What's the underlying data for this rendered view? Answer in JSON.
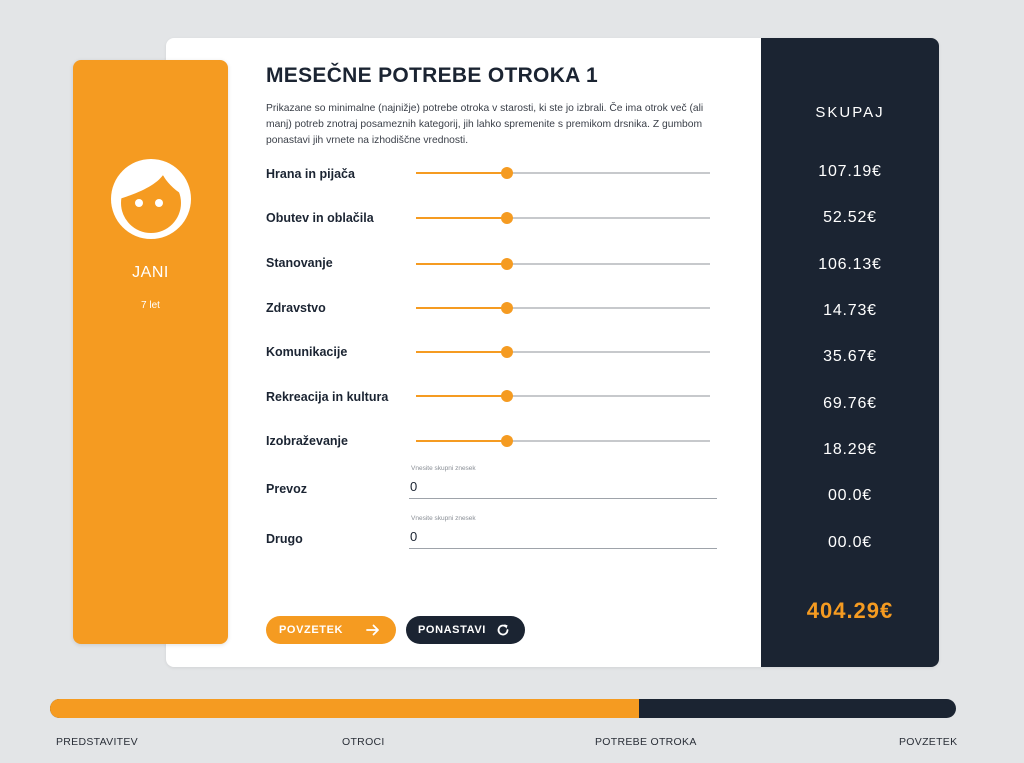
{
  "child": {
    "name": "JANI",
    "age": "7 let",
    "avatar_icon": "child-face-icon"
  },
  "main": {
    "title": "MESEČNE POTREBE OTROKA 1",
    "description": "Prikazane so minimalne (najnižje) potrebe otroka v starosti, ki ste jo izbrali. Če ima otrok več (ali manj) potreb znotraj posameznih kategorij, jih lahko spremenite s premikom drsnika. Z gumbom ponastavi jih vrnete na izhodiščne vrednosti.",
    "sliders": [
      {
        "label": "Hrana in pijača",
        "level": 0.31
      },
      {
        "label": "Obutev in oblačila",
        "level": 0.31
      },
      {
        "label": "Stanovanje",
        "level": 0.31
      },
      {
        "label": "Zdravstvo",
        "level": 0.31
      },
      {
        "label": "Komunikacije",
        "level": 0.31
      },
      {
        "label": "Rekreacija in kultura",
        "level": 0.31
      },
      {
        "label": "Izobraževanje",
        "level": 0.31
      }
    ],
    "inputs": [
      {
        "label": "Prevoz",
        "field_label": "Vnesite skupni znesek",
        "value": "0"
      },
      {
        "label": "Drugo",
        "field_label": "Vnesite skupni znesek",
        "value": "0"
      }
    ],
    "buttons": {
      "summary_label": "POVZETEK",
      "summary_icon": "arrow-right-icon",
      "reset_label": "PONASTAVI",
      "reset_icon": "refresh-icon"
    }
  },
  "totals": {
    "title": "SKUPAJ",
    "amounts": [
      "107.19€",
      "52.52€",
      "106.13€",
      "14.73€",
      "35.67€",
      "69.76€",
      "18.29€",
      "00.0€",
      "00.0€"
    ],
    "grand_total": "404.29€"
  },
  "progress": {
    "fraction": 0.65,
    "steps": [
      "PREDSTAVITEV",
      "OTROCI",
      "POTREBE OTROKA",
      "POVZETEK"
    ]
  },
  "colors": {
    "accent": "#f59b21",
    "dark": "#1b2432",
    "background": "#e3e5e7"
  }
}
